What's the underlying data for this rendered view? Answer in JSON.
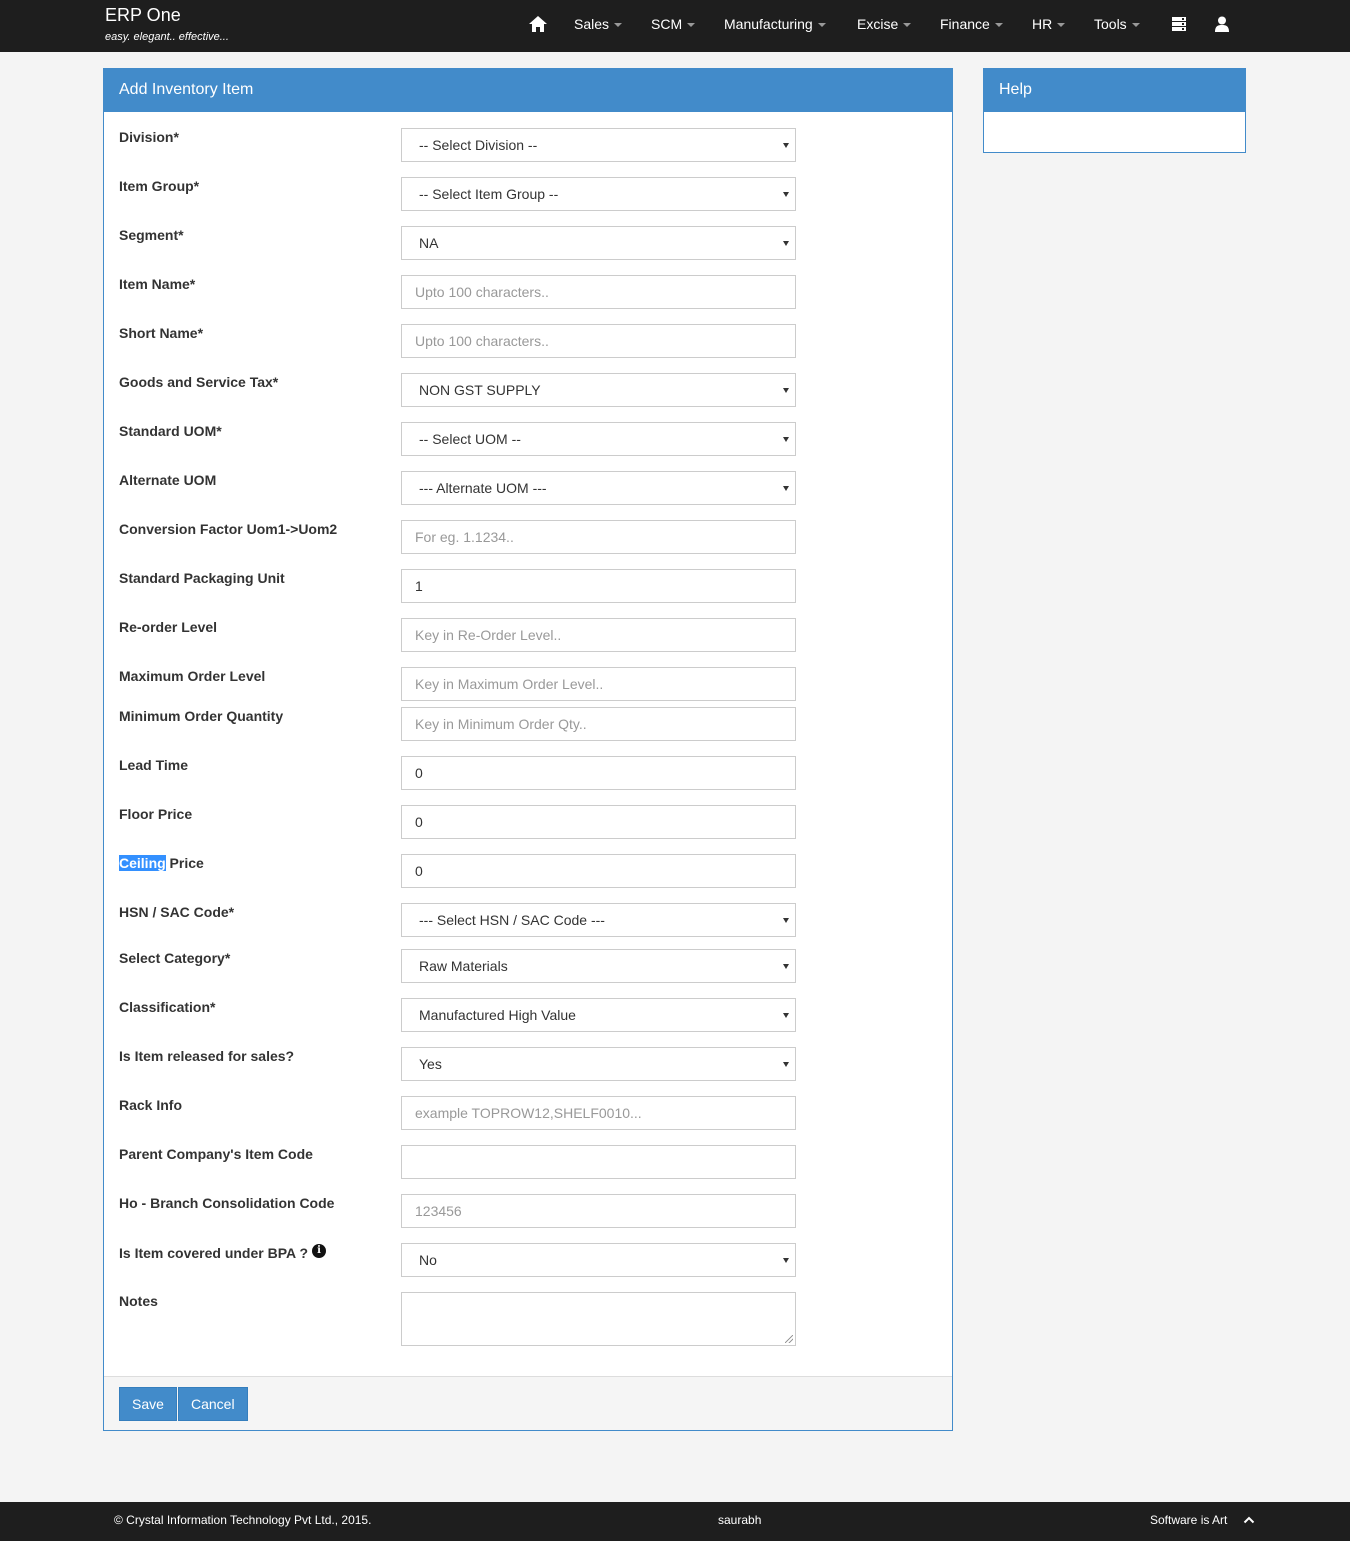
{
  "navbar": {
    "brand_title": "ERP One",
    "brand_tagline": "easy. elegant.. effective...",
    "menu": [
      {
        "label": "Sales"
      },
      {
        "label": "SCM"
      },
      {
        "label": "Manufacturing"
      },
      {
        "label": "Excise"
      },
      {
        "label": "Finance"
      },
      {
        "label": "HR"
      },
      {
        "label": "Tools"
      }
    ],
    "icons": [
      "home-icon",
      "server-icon",
      "user-icon"
    ]
  },
  "form": {
    "title": "Add Inventory Item",
    "fields": [
      {
        "label": "Division*",
        "type": "select",
        "value": "-- Select Division --"
      },
      {
        "label": "Item Group*",
        "type": "select",
        "value": "-- Select Item Group --"
      },
      {
        "label": "Segment*",
        "type": "select",
        "value": "NA"
      },
      {
        "label": "Item Name*",
        "type": "input",
        "value": "",
        "placeholder": "Upto 100 characters.."
      },
      {
        "label": "Short Name*",
        "type": "input",
        "value": "",
        "placeholder": "Upto 100 characters.."
      },
      {
        "label": "Goods and Service Tax*",
        "type": "select",
        "value": "NON GST SUPPLY"
      },
      {
        "label": "Standard UOM*",
        "type": "select",
        "value": "-- Select UOM --"
      },
      {
        "label": "Alternate UOM",
        "type": "select",
        "value": "--- Alternate UOM ---"
      },
      {
        "label": "Conversion Factor Uom1->Uom2",
        "type": "input",
        "value": "",
        "placeholder": "For eg. 1.1234.."
      },
      {
        "label": "Standard Packaging Unit",
        "type": "input",
        "value": "1",
        "placeholder": ""
      },
      {
        "label": "Re-order Level",
        "type": "input",
        "value": "",
        "placeholder": "Key in Re-Order Level.."
      },
      {
        "label": "Maximum Order Level",
        "type": "input",
        "value": "",
        "placeholder": "Key in Maximum Order Level.."
      },
      {
        "label": "Minimum Order Quantity",
        "type": "input",
        "value": "",
        "placeholder": "Key in Minimum Order Qty.."
      },
      {
        "label": "Lead Time",
        "type": "input",
        "value": "0",
        "placeholder": ""
      },
      {
        "label": "Floor Price",
        "type": "input",
        "value": "0",
        "placeholder": ""
      },
      {
        "label_selected": "Ceiling",
        "label_rest": " Price",
        "type": "input",
        "value": "0",
        "placeholder": ""
      },
      {
        "label": "HSN / SAC Code*",
        "type": "select",
        "value": "--- Select HSN / SAC Code ---"
      },
      {
        "label": "Select Category*",
        "type": "select",
        "value": "Raw Materials"
      },
      {
        "label": "Classification*",
        "type": "select",
        "value": "Manufactured High Value"
      },
      {
        "label": "Is Item released for sales?",
        "type": "select",
        "value": "Yes"
      },
      {
        "label": "Rack Info",
        "type": "input",
        "value": "",
        "placeholder": "example TOPROW12,SHELF0010..."
      },
      {
        "label": "Parent Company's Item Code",
        "type": "input",
        "value": "",
        "placeholder": ""
      },
      {
        "label": "Ho - Branch Consolidation Code",
        "type": "input",
        "value": "",
        "placeholder": "123456"
      },
      {
        "label": "Is Item covered under BPA ?",
        "type": "select",
        "value": "No",
        "info_icon": "i"
      },
      {
        "label": "Notes",
        "type": "textarea",
        "value": ""
      }
    ],
    "buttons": {
      "save": "Save",
      "cancel": "Cancel"
    }
  },
  "help": {
    "title": "Help"
  },
  "footer": {
    "copyright": "© Crystal Information Technology Pvt Ltd., 2015.",
    "user": "saurabh",
    "slogan": "Software is Art"
  },
  "colors": {
    "accent": "#428bca",
    "navbar_bg": "#1e1e1e",
    "page_bg": "#f4f4f4",
    "selection": "#3390ff"
  }
}
